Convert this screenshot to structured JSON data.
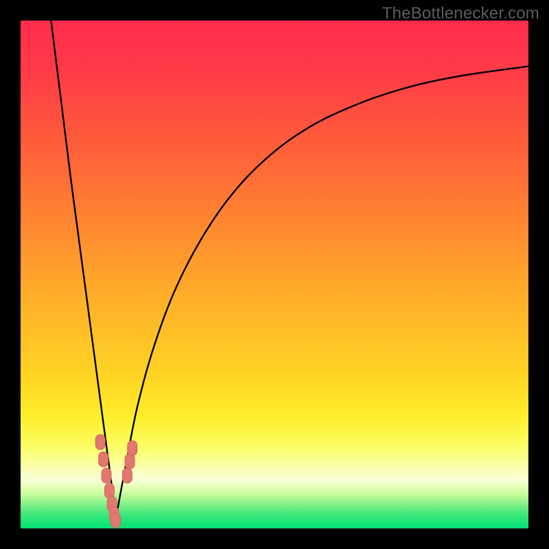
{
  "watermark": {
    "text": "TheBottlenecker.com"
  },
  "colors": {
    "frame": "#000000",
    "curve_stroke": "#000000",
    "marker_fill": "#e2786f",
    "marker_stroke": "#d6665e"
  },
  "chart_data": {
    "type": "line",
    "title": "",
    "xlabel": "",
    "ylabel": "",
    "xlim": [
      0,
      100
    ],
    "ylim": [
      0,
      100
    ],
    "grid": false,
    "legend": false,
    "background": {
      "type": "vertical-gradient",
      "stops": [
        {
          "offset": 0.0,
          "color": "#ff2c4d"
        },
        {
          "offset": 0.1,
          "color": "#ff3b47"
        },
        {
          "offset": 0.25,
          "color": "#ff5f3a"
        },
        {
          "offset": 0.4,
          "color": "#ff8730"
        },
        {
          "offset": 0.55,
          "color": "#ffb029"
        },
        {
          "offset": 0.7,
          "color": "#ffd423"
        },
        {
          "offset": 0.78,
          "color": "#ffee2a"
        },
        {
          "offset": 0.84,
          "color": "#fbff66"
        },
        {
          "offset": 0.88,
          "color": "#faffb0"
        },
        {
          "offset": 0.905,
          "color": "#f8ffd8"
        },
        {
          "offset": 0.925,
          "color": "#d9ffa8"
        },
        {
          "offset": 0.94,
          "color": "#aef893"
        },
        {
          "offset": 0.955,
          "color": "#79ef86"
        },
        {
          "offset": 0.975,
          "color": "#36e77a"
        },
        {
          "offset": 1.0,
          "color": "#00e173"
        }
      ]
    },
    "series": [
      {
        "name": "left-branch",
        "x": [
          6.0,
          7.0,
          8.0,
          9.0,
          10.0,
          11.0,
          12.0,
          13.0,
          14.0,
          15.0,
          16.0,
          17.0,
          18.0,
          18.7
        ],
        "y": [
          100.0,
          92.0,
          84.0,
          76.0,
          68.0,
          60.5,
          53.0,
          45.5,
          38.0,
          30.5,
          23.0,
          15.5,
          8.0,
          1.5
        ]
      },
      {
        "name": "right-branch",
        "x": [
          18.7,
          19.5,
          21.0,
          23.0,
          26.0,
          30.0,
          35.0,
          41.0,
          48.0,
          56.0,
          65.0,
          75.0,
          86.0,
          100.0
        ],
        "y": [
          1.5,
          6.0,
          14.0,
          24.0,
          35.0,
          46.0,
          56.0,
          65.0,
          72.5,
          78.5,
          83.0,
          86.5,
          89.0,
          91.0
        ]
      }
    ],
    "markers": {
      "name": "highlight-dots",
      "shape": "rounded-rect",
      "points": [
        {
          "x": 15.7,
          "y": 17.0
        },
        {
          "x": 16.3,
          "y": 13.6
        },
        {
          "x": 16.9,
          "y": 10.4
        },
        {
          "x": 17.5,
          "y": 7.4
        },
        {
          "x": 18.0,
          "y": 4.8
        },
        {
          "x": 18.4,
          "y": 2.8
        },
        {
          "x": 18.7,
          "y": 1.6
        },
        {
          "x": 21.0,
          "y": 10.4
        },
        {
          "x": 21.5,
          "y": 13.2
        },
        {
          "x": 22.0,
          "y": 15.8
        }
      ]
    }
  }
}
